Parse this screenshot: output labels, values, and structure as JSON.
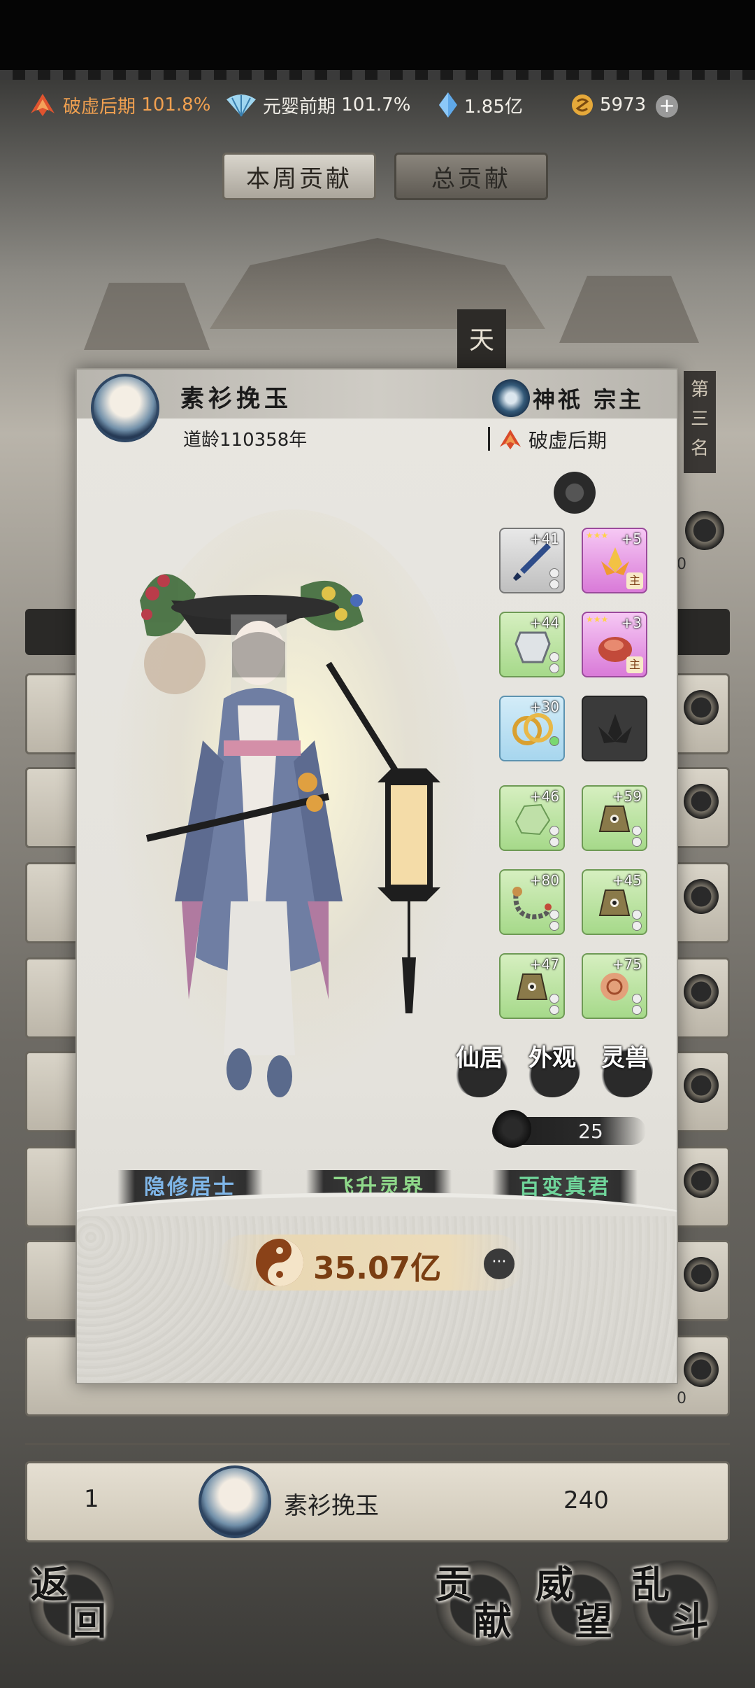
{
  "status_bar": {
    "realm1": {
      "name": "破虚后期",
      "percent": "101.8%"
    },
    "realm2": {
      "name": "元婴前期",
      "percent": "101.7%"
    },
    "spirit_stones": "1.85亿",
    "currency": "5973"
  },
  "tabs": [
    "本周贡献",
    "总贡献"
  ],
  "rank_badge": [
    "第",
    "三",
    "名"
  ],
  "tower_char": "天",
  "list_zero": "0",
  "modal": {
    "name": "素衫挽玉",
    "age": "道龄110358年",
    "sect": "神祇 宗主",
    "realm": "破虚后期",
    "equipment": [
      {
        "color": "grey",
        "icon": "sword-icon",
        "level": "+41"
      },
      {
        "color": "pink",
        "icon": "lotus-artifact-icon",
        "level": "+5",
        "main": "主"
      },
      {
        "color": "green",
        "icon": "armor-icon",
        "level": "+44"
      },
      {
        "color": "pink",
        "icon": "red-stone-icon",
        "level": "+3",
        "main": "主"
      },
      {
        "color": "blue",
        "icon": "rings-icon",
        "level": "+30"
      },
      {
        "color": "dark",
        "icon": "lotus-locked-icon",
        "level": ""
      },
      {
        "color": "green",
        "icon": "jade-stone-icon",
        "level": "+46"
      },
      {
        "color": "green",
        "icon": "bell-icon",
        "level": "+59"
      },
      {
        "color": "green",
        "icon": "chain-whip-icon",
        "level": "+80"
      },
      {
        "color": "green",
        "icon": "bell-icon",
        "level": "+45"
      },
      {
        "color": "green",
        "icon": "bell-icon",
        "level": "+47"
      },
      {
        "color": "green",
        "icon": "orb-icon",
        "level": "+75"
      }
    ],
    "functions": [
      "仙居",
      "外观",
      "灵兽"
    ],
    "power_level": "25",
    "titles": [
      "隐修居士",
      "飞升灵界",
      "百变真君"
    ],
    "combat_power": "35.07亿",
    "more_label": "···"
  },
  "my_row": {
    "rank": "1",
    "name": "素衫挽玉",
    "score": "240"
  },
  "bottom_buttons": [
    {
      "label": [
        "返",
        "回"
      ]
    },
    {
      "label": [
        "贡",
        "献"
      ]
    },
    {
      "label": [
        "威",
        "望"
      ]
    },
    {
      "label": [
        "乱",
        "斗"
      ]
    }
  ],
  "colors": {
    "accent_orange": "#f0a050",
    "combat_power": "#7a3e12",
    "title_blue": "#7fb6e8",
    "title_green": "#8fd98a"
  }
}
